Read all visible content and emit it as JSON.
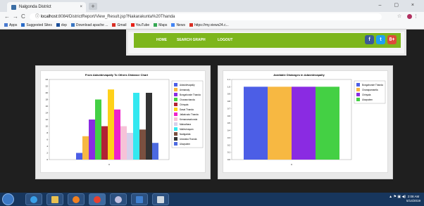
{
  "browser": {
    "tab_title": "Nalgonda District",
    "tab_close": "×",
    "new_tab": "+",
    "back": "←",
    "forward": "→",
    "reload": "C",
    "info": "ⓘ",
    "url_host": "localhost",
    "url_path": ":8084/DistrictReport/View_Result.jsp?Nakarakunta%20Thanda",
    "star": "☆",
    "menu": "⋮",
    "window_controls": "– ▢ ×",
    "bookmarks": [
      {
        "label": "Apps",
        "color": "#4a7bd0"
      },
      {
        "label": "Suggested Sites",
        "color": "#2a6cc8"
      },
      {
        "label": "dvp",
        "color": "#1b4f9a"
      },
      {
        "label": "Download apache ...",
        "color": "#3a77c2"
      },
      {
        "label": "Gmail",
        "color": "#d93025"
      },
      {
        "label": "YouTube",
        "color": "#e62117"
      },
      {
        "label": "Maps",
        "color": "#34a853"
      },
      {
        "label": "News",
        "color": "#4285f4"
      },
      {
        "label": "https://my.views24.c...",
        "color": "#d93025"
      }
    ]
  },
  "nav": {
    "home": "HOME",
    "search_graph": "SEARCH GRAPH",
    "logout": "LOGOUT",
    "facebook": "f",
    "twitter": "t",
    "googleplus": "8+"
  },
  "colors": {
    "nav_green": "#7db61c",
    "facebook": "#3b5998",
    "twitter": "#1da1f2",
    "googleplus": "#dd4b39"
  },
  "chart_data": [
    {
      "type": "bar",
      "title": "From Adavidevapally To Others Distance Chart",
      "categories": [
        "Adavidevapally",
        "Anmanaly",
        "Bongahunde Thanda",
        "Chananchanda",
        "Chinyala",
        "Dasai Thanda",
        "Jalkalvudu Thanda",
        "Kemanarsahonda",
        "Mahadhara",
        "Mallevinayam",
        "Nadigadda",
        "Udanaka Thanda",
        "Ulavpalem"
      ],
      "series": [
        {
          "name": "Adavidevapally",
          "color": "#4c5ee6",
          "value": 2
        },
        {
          "name": "Anmanaly",
          "color": "#f7b842",
          "value": 7
        },
        {
          "name": "Bongahunde Thanda",
          "color": "#8a2be2",
          "value": 12
        },
        {
          "name": "Chananchanda",
          "color": "#44d044",
          "value": 18
        },
        {
          "name": "Chinyala",
          "color": "#b22234",
          "value": 10
        },
        {
          "name": "Dasai Thanda",
          "color": "#ffd11a",
          "value": 21
        },
        {
          "name": "Jalkalvudu Thanda",
          "color": "#ee22cc",
          "value": 15
        },
        {
          "name": "Kemanarsahonda",
          "color": "#f6c2d8",
          "value": 10
        },
        {
          "name": "Mahadhara",
          "color": "#d6d0ea",
          "value": 8
        },
        {
          "name": "Mallevinayam",
          "color": "#33e8f0",
          "value": 20
        },
        {
          "name": "Nadigadda",
          "color": "#7a5040",
          "value": 9
        },
        {
          "name": "Udanaka Thanda",
          "color": "#333333",
          "value": 20
        },
        {
          "name": "Ulavpalem",
          "color": "#4c6ae0",
          "value": 5
        }
      ],
      "yticks": [
        "0",
        "2",
        "4",
        "6",
        "8",
        "10",
        "12",
        "14",
        "16",
        "18",
        "20",
        "22",
        "24"
      ],
      "ylim": [
        0,
        24
      ],
      "xlabel": "0",
      "legend": "right"
    },
    {
      "type": "bar",
      "title": "Available Distanges in Adavidevapally",
      "series": [
        {
          "name": "Bongahunde Thanda",
          "color": "#4c5ee6",
          "value": 1.0
        },
        {
          "name": "Chanapamantla",
          "color": "#f7b842",
          "value": 1.0
        },
        {
          "name": "Chinyala",
          "color": "#8a2be2",
          "value": 1.0
        },
        {
          "name": "Ulavpalem",
          "color": "#44d044",
          "value": 1.0
        }
      ],
      "yticks": [
        "0.0",
        "0.1",
        "0.2",
        "0.3",
        "0.4",
        "0.5",
        "0.6",
        "0.7",
        "0.8",
        "0.9",
        "1.0",
        "1.1"
      ],
      "ylim": [
        0,
        1.1
      ],
      "xlabel": "0",
      "legend": "right"
    }
  ],
  "taskbar": {
    "tray_icons": "▲ ⚑ ▣ ◀)",
    "time": "2:08 AM",
    "date": "5/14/2019"
  }
}
